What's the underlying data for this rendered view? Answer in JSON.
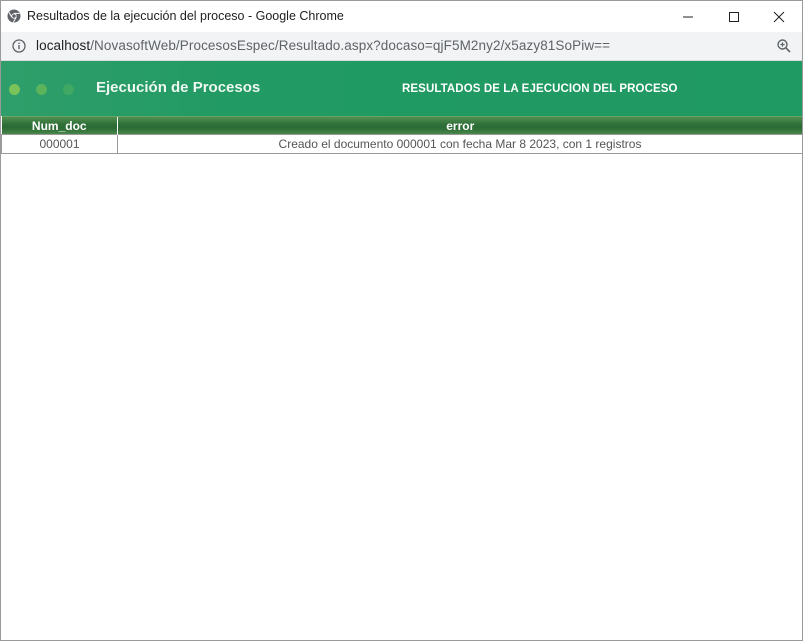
{
  "window": {
    "title": "Resultados de la ejecución del proceso - Google Chrome"
  },
  "addressbar": {
    "url_host": "localhost",
    "url_path": "/NovasoftWeb/ProcesosEspec/Resultado.aspx?docaso=qjF5M2ny2/x5azy81SoPiw=="
  },
  "header": {
    "title": "Ejecución de Procesos",
    "subtitle": "RESULTADOS DE LA EJECUCION DEL PROCESO"
  },
  "table": {
    "columns": [
      "Num_doc",
      "error"
    ],
    "rows": [
      [
        "000001",
        "Creado el documento 000001 con fecha Mar 8 2023, con 1 registros"
      ]
    ]
  },
  "colors": {
    "banner": "#219a63",
    "table_header": "#2f6f38"
  }
}
